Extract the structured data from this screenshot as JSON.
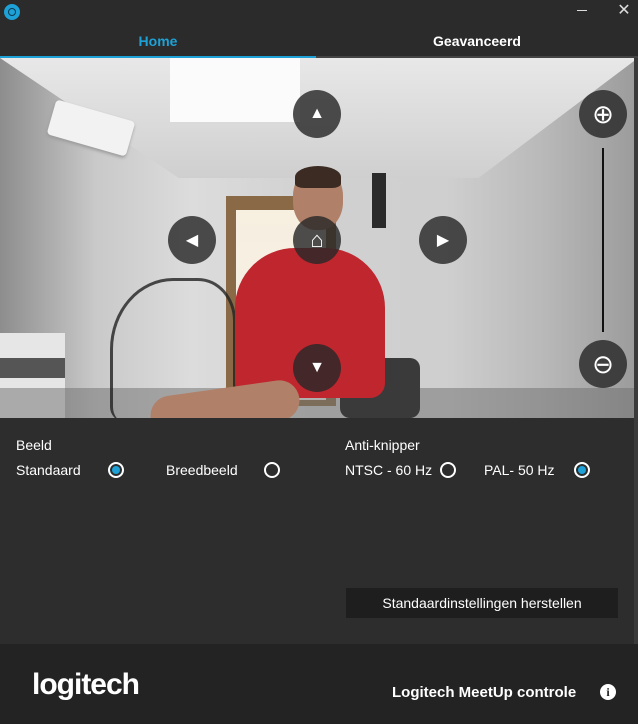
{
  "window": {
    "minimize_glyph": "",
    "close_glyph": "✕"
  },
  "tabs": [
    {
      "label": "Home",
      "active": true
    },
    {
      "label": "Geavanceerd",
      "active": false
    }
  ],
  "camera_controls": {
    "up_glyph": "▲",
    "down_glyph": "▼",
    "left_glyph": "◀",
    "right_glyph": "▶",
    "home_glyph": "⌂",
    "zoom_in_glyph": "⊕",
    "zoom_out_glyph": "⊖"
  },
  "image": {
    "title": "Beeld",
    "options": [
      {
        "label": "Standaard",
        "selected": true
      },
      {
        "label": "Breedbeeld",
        "selected": false
      }
    ]
  },
  "antiflicker": {
    "title": "Anti-knipper",
    "options": [
      {
        "label": "NTSC - 60 Hz",
        "selected": false
      },
      {
        "label": "PAL- 50 Hz",
        "selected": true
      }
    ]
  },
  "reset_label": "Standaardinstellingen herstellen",
  "footer": {
    "logo": "logitech",
    "title": "Logitech MeetUp controle",
    "info_glyph": "i"
  },
  "colors": {
    "accent": "#1da1d6",
    "background": "#2d2d2d",
    "footer": "#232323"
  }
}
